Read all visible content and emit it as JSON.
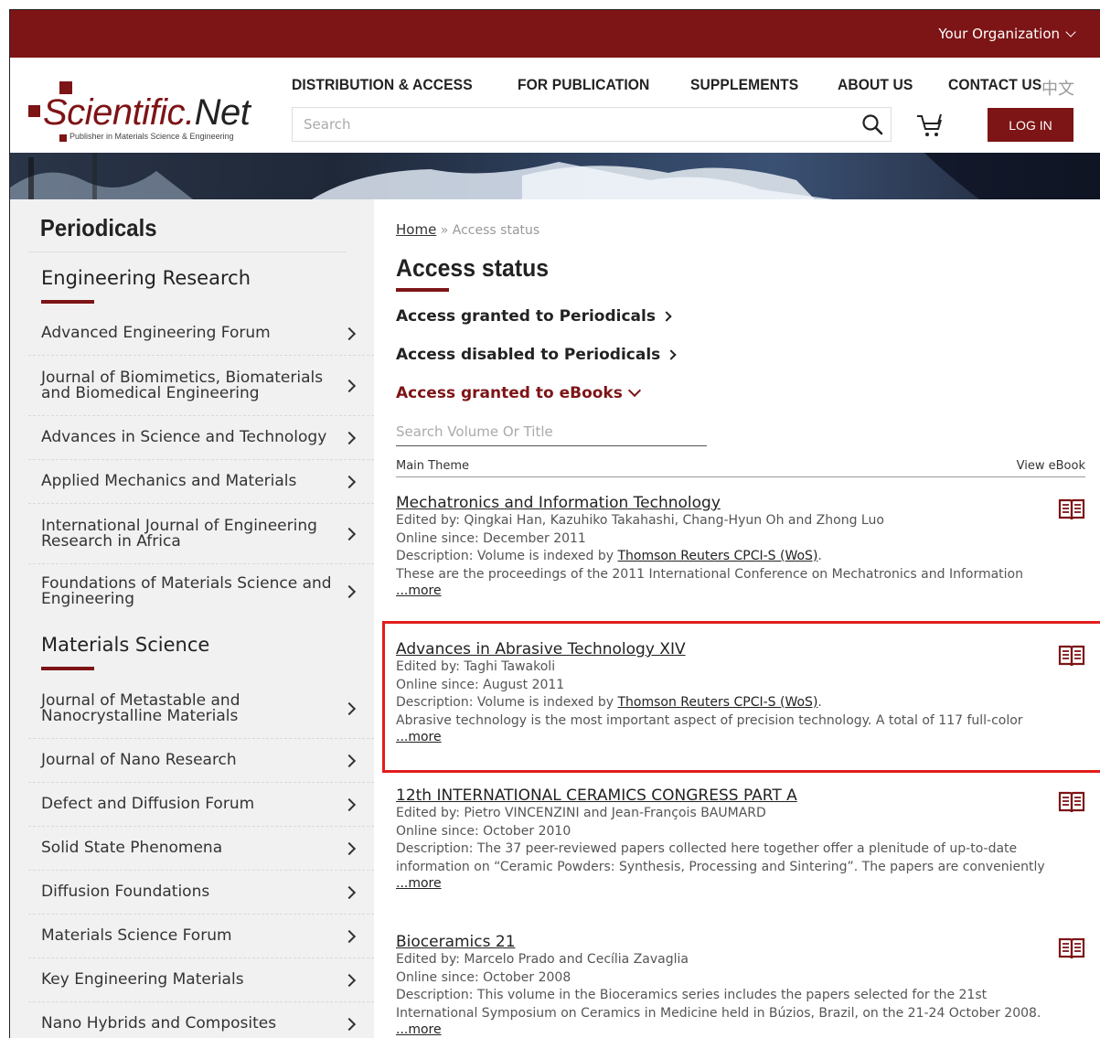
{
  "topbar": {
    "org_label": "Your Organization"
  },
  "header": {
    "logo_text_main": "Scientific.",
    "logo_text_end": "Net",
    "logo_tagline": "Publisher in Materials Science & Engineering",
    "nav": [
      "DISTRIBUTION & ACCESS",
      "FOR PUBLICATION",
      "SUPPLEMENTS",
      "ABOUT US",
      "CONTACT US"
    ],
    "lang": "中文",
    "search_placeholder": "Search",
    "login_label": "LOG IN"
  },
  "sidebar": {
    "title": "Periodicals",
    "groups": [
      {
        "title": "Engineering Research",
        "items": [
          "Advanced Engineering Forum",
          "Journal of Biomimetics, Biomaterials and Biomedical Engineering",
          "Advances in Science and Technology",
          "Applied Mechanics and Materials",
          "International Journal of Engineering Research in Africa",
          "Foundations of Materials Science and Engineering"
        ]
      },
      {
        "title": "Materials Science",
        "items": [
          "Journal of Metastable and Nanocrystalline Materials",
          "Journal of Nano Research",
          "Defect and Diffusion Forum",
          "Solid State Phenomena",
          "Diffusion Foundations",
          "Materials Science Forum",
          "Key Engineering Materials",
          "Nano Hybrids and Composites"
        ]
      }
    ]
  },
  "main": {
    "breadcrumb_home": "Home",
    "breadcrumb_sep": "»",
    "breadcrumb_current": "Access status",
    "title": "Access status",
    "access_periodicals_granted": "Access granted to Periodicals",
    "access_periodicals_disabled": "Access disabled to Periodicals",
    "access_ebooks_granted": "Access granted to eBooks",
    "volume_search_placeholder": "Search Volume Or Title",
    "col_main_theme": "Main Theme",
    "col_view_ebook": "View eBook",
    "books": [
      {
        "title": "Mechatronics and Information Technology",
        "edited": "Edited by: Qingkai Han, Kazuhiko Takahashi, Chang-Hyun Oh and Zhong Luo",
        "online": "Online since: December 2011",
        "desc_prefix": "Description: Volume is indexed by ",
        "desc_link": "Thomson Reuters CPCI-S (WoS)",
        "desc_suffix": ".",
        "desc_text": "These are the proceedings of the 2011 International Conference on Mechatronics and Information",
        "more": "...more"
      },
      {
        "title": "Advances in Abrasive Technology XIV",
        "edited": "Edited by: Taghi Tawakoli",
        "online": "Online since: August 2011",
        "desc_prefix": "Description: Volume is indexed by ",
        "desc_link": "Thomson Reuters CPCI-S (WoS)",
        "desc_suffix": ".",
        "desc_text": "Abrasive technology is the most important aspect of precision technology. A total of 117 full-color",
        "more": "...more"
      },
      {
        "title": "12th INTERNATIONAL CERAMICS CONGRESS PART A",
        "edited": "Edited by: Pietro VINCENZINI and Jean-François BAUMARD",
        "online": "Online since: October 2010",
        "desc_prefix": "Description: The 37 peer-reviewed papers collected here together offer a plenitude of up-to-date information on “Ceramic Powders: Synthesis, Processing and Sintering”. The papers are conveniently",
        "desc_link": "",
        "desc_suffix": "",
        "desc_text": "",
        "more": "...more"
      },
      {
        "title": "Bioceramics 21",
        "edited": "Edited by: Marcelo Prado and Cecília Zavaglia",
        "online": "Online since: October 2008",
        "desc_prefix": "Description: This volume in the Bioceramics series includes the papers selected for the 21st International Symposium on Ceramics in Medicine held in Búzios, Brazil, on the 21-24 October 2008.",
        "desc_link": "",
        "desc_suffix": "",
        "desc_text": "",
        "more": "...more"
      }
    ]
  },
  "colors": {
    "brand": "#7d1416",
    "highlight": "#e21d1d"
  }
}
